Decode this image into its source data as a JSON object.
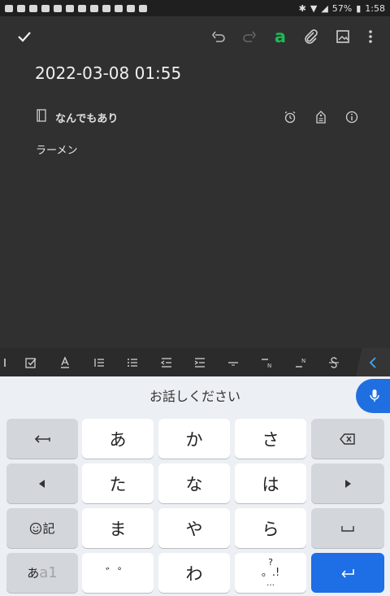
{
  "status_bar": {
    "battery": "57%",
    "time": "1:58"
  },
  "toolbar": {
    "text_style_label": "a"
  },
  "note": {
    "title": "2022-03-08 01:55",
    "notebook": "なんでもあり",
    "body": "ラーメン"
  },
  "keyboard": {
    "voice_hint": "お話しください",
    "keys": {
      "a": "あ",
      "ka": "か",
      "sa": "さ",
      "ta": "た",
      "na": "な",
      "ha": "は",
      "ma": "ま",
      "ya": "や",
      "ra": "ら",
      "kigou": "記",
      "mode_kana": "あ",
      "mode_alpha": "a1",
      "dakuten": "゛゜",
      "wa": "わ",
      "punct_top": "?",
      "punct_mid": "。.!",
      "punct_bottom": "…"
    }
  },
  "colors": {
    "accent_green": "#1db954",
    "keyboard_blue": "#1e6ee6",
    "background": "#303030"
  }
}
